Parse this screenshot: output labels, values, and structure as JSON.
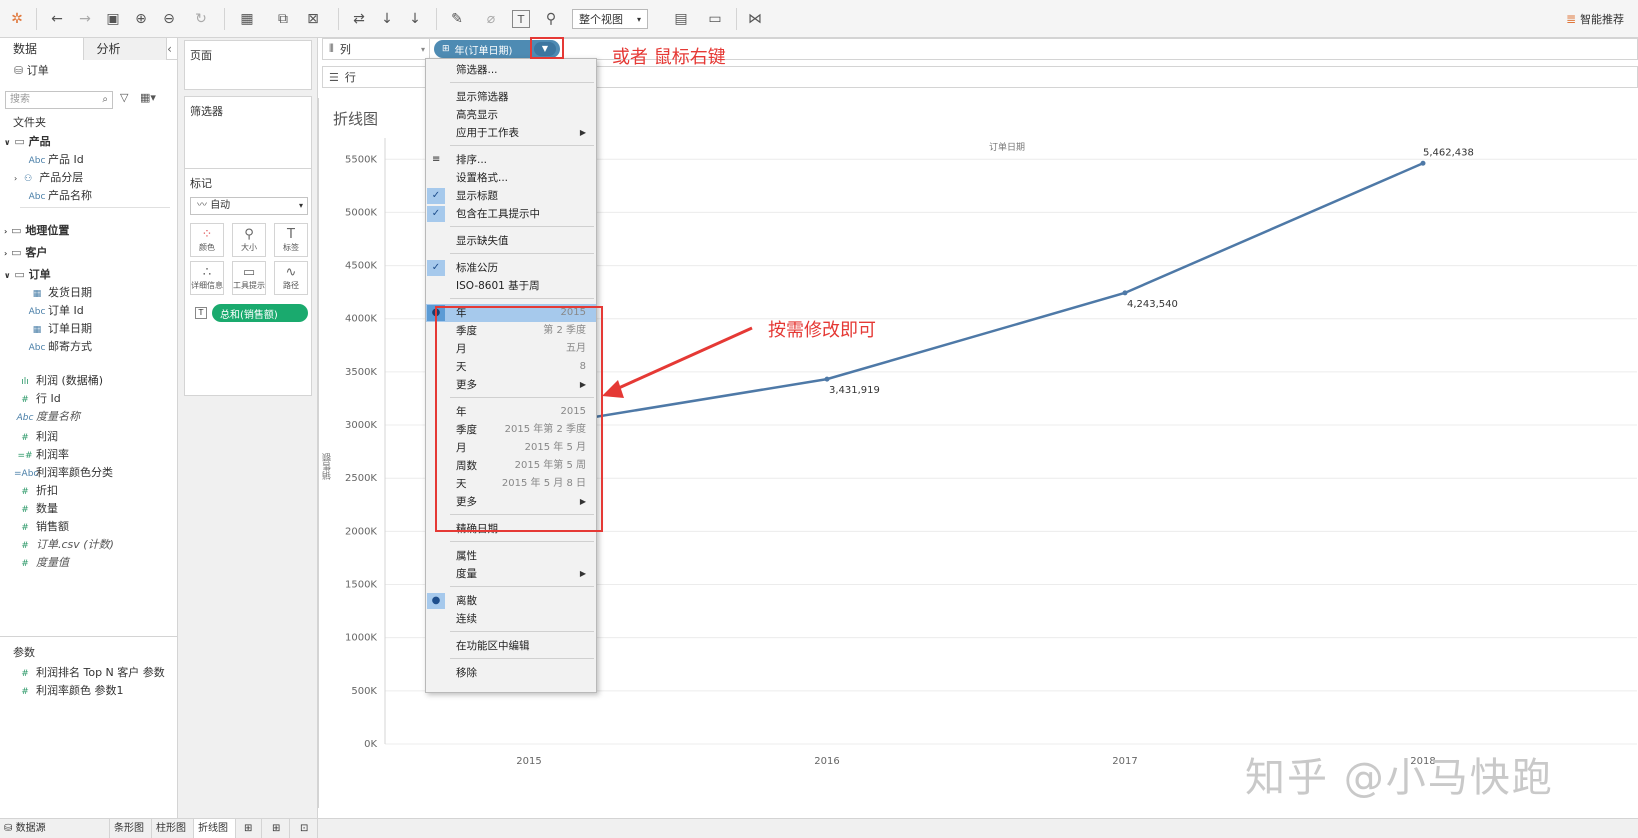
{
  "toolbar": {
    "view_select": "整个视图",
    "smart_recommend": "智能推荐"
  },
  "datapane": {
    "tab_data": "数据",
    "tab_analysis": "分析",
    "datasource": "订单",
    "search_placeholder": "搜索",
    "folders_header": "文件夹",
    "product_group": "产品",
    "product_items": [
      "产品 Id",
      "产品分层",
      "产品名称"
    ],
    "geo_group": "地理位置",
    "customer_group": "客户",
    "order_group": "订单",
    "order_items": [
      "发货日期",
      "订单 Id",
      "订单日期",
      "邮寄方式"
    ],
    "measures": [
      "利润 (数据桶)",
      "行 Id",
      "度量名称",
      "利润",
      "利润率",
      "利润率颜色分类",
      "折扣",
      "数量",
      "销售额",
      "订单.csv (计数)",
      "度量值"
    ],
    "params_header": "参数",
    "params": [
      "利润排名 Top N 客户 参数",
      "利润率颜色 参数1"
    ]
  },
  "shelves": {
    "pages": "页面",
    "filters": "筛选器",
    "marks": "标记",
    "mark_type": "自动",
    "mark_buttons": [
      "颜色",
      "大小",
      "标签",
      "详细信息",
      "工具提示",
      "路径"
    ],
    "mark_pill": "总和(销售额)",
    "columns_label": "列",
    "rows_label": "行",
    "column_pill": "年(订单日期)"
  },
  "viz": {
    "title": "折线图",
    "top_axis_label": "订单日期",
    "y_axis_label": "销售额"
  },
  "chart_data": {
    "type": "line",
    "x": [
      "2015",
      "2016",
      "2017",
      "2018"
    ],
    "series": [
      {
        "values": [
          2975000,
          3431919,
          4243540,
          5462438
        ]
      }
    ],
    "data_labels": [
      "",
      "3,431,919",
      "4,243,540",
      "5,462,438"
    ],
    "y_ticks": [
      "0K",
      "500K",
      "1000K",
      "1500K",
      "2000K",
      "2500K",
      "3000K",
      "3500K",
      "4000K",
      "4500K",
      "5000K",
      "5500K"
    ],
    "ylim": [
      0,
      5700000
    ],
    "line_color": "#4e79a7"
  },
  "menu": {
    "filter": "筛选器...",
    "show_filter": "显示筛选器",
    "highlight": "高亮显示",
    "apply_to_worksheets": "应用于工作表",
    "sort": "排序...",
    "format": "设置格式...",
    "show_title": "显示标题",
    "include_tooltip": "包含在工具提示中",
    "show_missing": "显示缺失值",
    "standard_calendar": "标准公历",
    "iso_week": "ISO-8601 基于周",
    "part_items": [
      {
        "label": "年",
        "value": "2015"
      },
      {
        "label": "季度",
        "value": "第 2 季度"
      },
      {
        "label": "月",
        "value": "五月"
      },
      {
        "label": "天",
        "value": "8"
      }
    ],
    "more1": "更多",
    "value_items": [
      {
        "label": "年",
        "value": "2015"
      },
      {
        "label": "季度",
        "value": "2015 年第 2 季度"
      },
      {
        "label": "月",
        "value": "2015 年 5 月"
      },
      {
        "label": "周数",
        "value": "2015 年第 5 周"
      },
      {
        "label": "天",
        "value": "2015 年 5 月 8 日"
      }
    ],
    "more2": "更多",
    "exact_date": "精确日期",
    "attribute": "属性",
    "measure": "度量",
    "discrete": "离散",
    "continuous": "连续",
    "edit_in_shelf": "在功能区中编辑",
    "remove": "移除"
  },
  "annotations": {
    "right_click": "或者 鼠标右键",
    "modify": "按需修改即可"
  },
  "bottom_tabs": {
    "datasource": "数据源",
    "sheets": [
      "条形图",
      "柱形图",
      "折线图"
    ]
  },
  "watermark": "知乎 @小马快跑",
  "colors": {
    "pill_blue": "#4e8bb3",
    "pill_green": "#1aaa6e",
    "annotation_red": "#e53935"
  }
}
